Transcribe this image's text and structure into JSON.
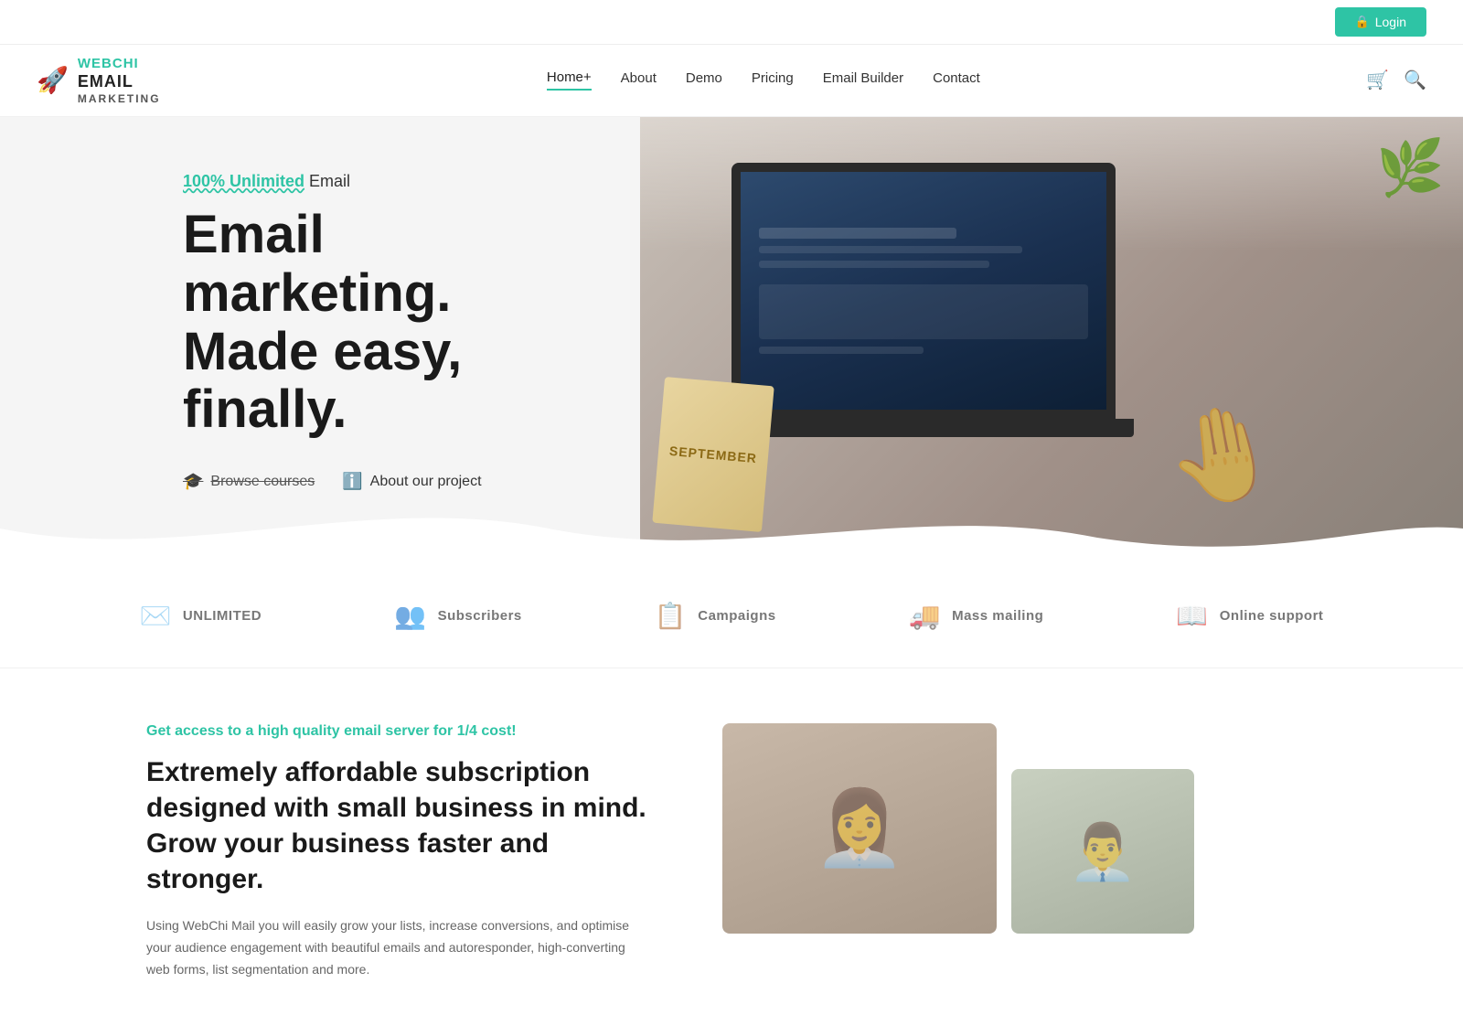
{
  "topbar": {
    "login_label": "Login"
  },
  "nav": {
    "logo": {
      "webchi": "WEBCHI",
      "email": "EMAIL",
      "marketing": "MARKETING"
    },
    "links": [
      {
        "id": "home",
        "label": "Home+",
        "active": true
      },
      {
        "id": "about",
        "label": "About",
        "active": false
      },
      {
        "id": "demo",
        "label": "Demo",
        "active": false
      },
      {
        "id": "pricing",
        "label": "Pricing",
        "active": false
      },
      {
        "id": "email-builder",
        "label": "Email Builder",
        "active": false
      },
      {
        "id": "contact",
        "label": "Contact",
        "active": false
      }
    ]
  },
  "hero": {
    "subtitle_highlight": "100% Unlimited",
    "subtitle_rest": " Email",
    "title_line1": "Email marketing.",
    "title_line2": "Made easy, finally.",
    "cta_browse": "Browse courses",
    "cta_about": "About our project",
    "notebook_text": "SEPTEMBER"
  },
  "features": [
    {
      "id": "unlimited",
      "label": "UNLIMITED",
      "icon": "✉"
    },
    {
      "id": "subscribers",
      "label": "Subscribers",
      "icon": "👥"
    },
    {
      "id": "campaigns",
      "label": "Campaigns",
      "icon": "📋"
    },
    {
      "id": "mass-mailing",
      "label": "Mass mailing",
      "icon": "🚚"
    },
    {
      "id": "online-support",
      "label": "Online support",
      "icon": "📖"
    }
  ],
  "content": {
    "eyebrow": "Get access to a high quality email server for 1/4 cost!",
    "title": "Extremely affordable subscription designed with small business in mind. Grow your business faster and stronger.",
    "body": "Using WebChi Mail you will easily grow your lists, increase conversions, and optimise your audience engagement with beautiful emails and autoresponder, high-converting web forms, list segmentation and more."
  },
  "colors": {
    "brand_green": "#2ec4a5",
    "dark": "#1a1a1a",
    "gray": "#777"
  }
}
